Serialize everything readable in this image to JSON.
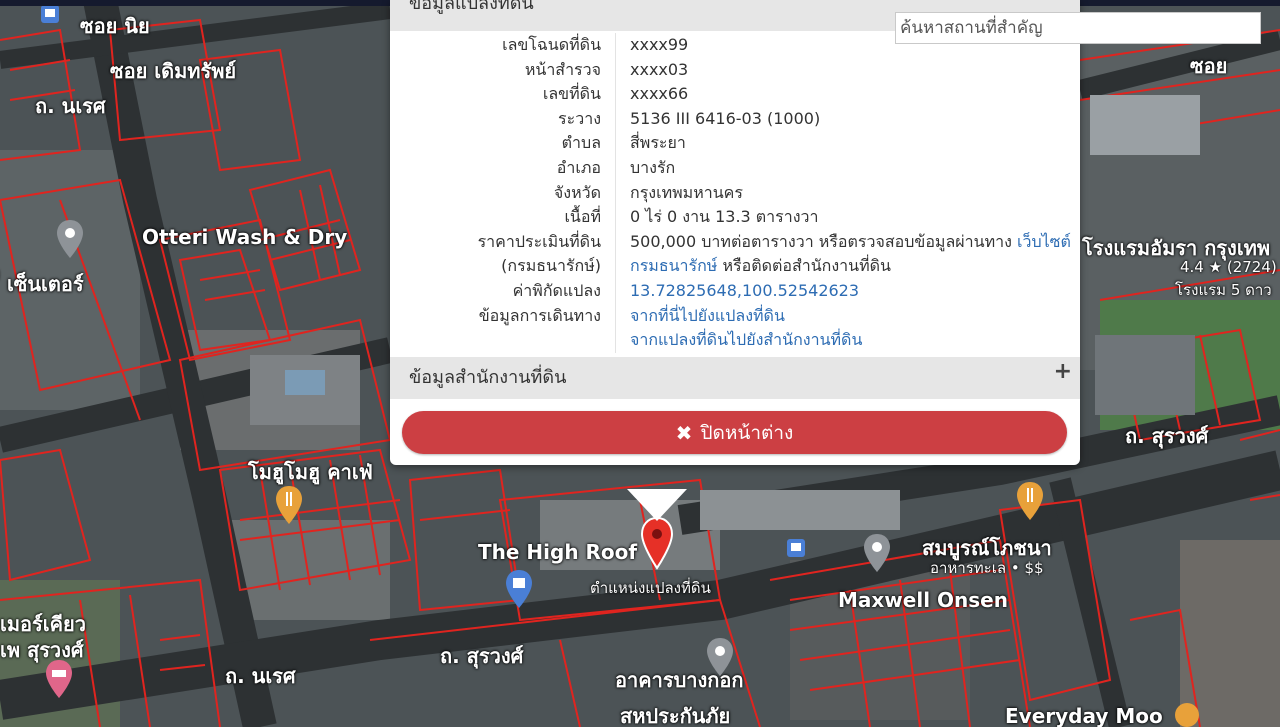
{
  "search": {
    "placeholder": "ค้นหาสถานที่สำคัญ"
  },
  "popup": {
    "section_title": "ข้อมูลแปลงที่ดิน",
    "rows": [
      {
        "label": "เลขโฉนดที่ดิน",
        "value": "xxxx99"
      },
      {
        "label": "หน้าสำรวจ",
        "value": "xxxx03"
      },
      {
        "label": "เลขที่ดิน",
        "value": "xxxx66"
      },
      {
        "label": "ระวาง",
        "value": "5136 III 6416-03 (1000)"
      },
      {
        "label": "ตำบล",
        "value": "สี่พระยา"
      },
      {
        "label": "อำเภอ",
        "value": "บางรัก"
      },
      {
        "label": "จังหวัด",
        "value": "กรุงเทพมหานคร"
      },
      {
        "label": "เนื้อที่",
        "value": "0 ไร่ 0 งาน 13.3 ตารางวา"
      }
    ],
    "price": {
      "label_line1": "ราคาประเมินที่ดิน",
      "label_line2": "(กรมธนารักษ์)",
      "value_text": "500,000 บาทต่อตารางวา หรือตรวจสอบข้อมูลผ่านทาง",
      "link1": "เว็บไซต์",
      "link2": "กรมธนารักษ์",
      "value_suffix": "หรือติดต่อสำนักงานที่ดิน"
    },
    "coords": {
      "label": "ค่าพิกัดแปลง",
      "value": "13.72825648,100.52542623"
    },
    "travel": {
      "label": "ข้อมูลการเดินทาง",
      "link_to_plot": "จากที่นี่ไปยังแปลงที่ดิน",
      "link_to_office": "จากแปลงที่ดินไปยังสำนักงานที่ดิน"
    },
    "office_section_title": "ข้อมูลสำนักงานที่ดิน",
    "close_label": "ปิดหน้าต่าง"
  },
  "map": {
    "labels": {
      "soi_1": "ซอย นิย",
      "soi_2": "ซอย เดิมทรัพย์",
      "road_nared_1": "ถ. นเรศ",
      "otteri": "Otteri Wash & Dry",
      "center": "ี่ เซ็นเตอร์",
      "momo": "โมฮูโมฮู คาเฟ่",
      "high_roof": "The High Roof",
      "plot_marker": "ตำแหน่งแปลงที่ดิน",
      "surawong_1": "ถ. สุรวงศ์",
      "surawong_2": "ถ. สุรวงศ์",
      "nared_2": "ถ. นเรศ",
      "mercure": "เมอร์เคียว",
      "mercure_2": "เพ สุรวงศ์",
      "bangkok_bldg": "อาคารบางกอก",
      "bangkok_bldg_2": "สหประกันภัย",
      "sompong": "สมบูรณ์โภชนา",
      "sompong_sub": "อาหารทะเล • $$",
      "maxwell": "Maxwell Onsen",
      "everyday": "Everyday Moo",
      "amara": "โรงแรมอัมรา กรุงเทพ",
      "amara_sub": "4.4 ★ (2724)",
      "amara_hotel": "โรงแรม 5 ดาว",
      "soi_right": "ซอย"
    }
  }
}
